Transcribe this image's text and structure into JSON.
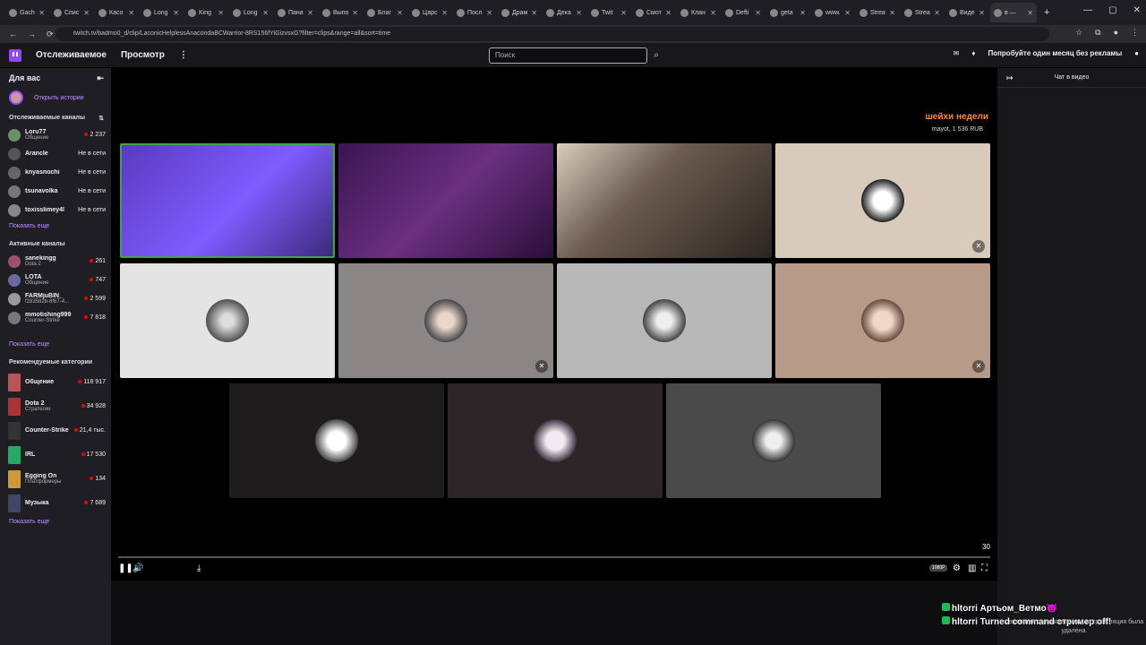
{
  "browser": {
    "tabs": [
      "Gach",
      "Спис",
      "Касо",
      "Long",
      "King",
      "Long",
      "Пана",
      "Выпо",
      "Благ",
      "Царс",
      "Посл",
      "Драм",
      "Дека",
      "Twit",
      "Смот",
      "Клан",
      "Defti",
      "geta",
      "www.",
      "Strea",
      "Strea",
      "Виде",
      "в —"
    ],
    "url": "twitch.tv/badmo0_d/clip/LaconicHelplessAnacondaBCWarrior-8RS156fYiGizvsxG?filter=clips&range=all&sort=time"
  },
  "topnav": {
    "following": "Отслеживаемое",
    "browse": "Просмотр",
    "more": "⋮",
    "search_placeholder": "Поиск",
    "promo": "Попробуйте один месяц без рекламы"
  },
  "sidebar": {
    "for_you": "Для вас",
    "stories": "Открыть истории",
    "followed_title": "Отслеживаемые каналы",
    "followed": [
      {
        "name": "Loru77",
        "game": "Общение",
        "viewers": "2 237",
        "live": true
      },
      {
        "name": "Arancle",
        "game": "",
        "viewers": "Не в сети",
        "live": false
      },
      {
        "name": "knyasnochi",
        "game": "",
        "viewers": "Не в сети",
        "live": false
      },
      {
        "name": "tsunavolka",
        "game": "",
        "viewers": "Не в сети",
        "live": false
      },
      {
        "name": "toxisslimey4l",
        "game": "",
        "viewers": "Не в сети",
        "live": false
      }
    ],
    "show_more_1": "Показать еще",
    "active_title": "Активные каналы",
    "active": [
      {
        "name": "sanekingg",
        "game": "Dota 2",
        "viewers": "261",
        "live": true
      },
      {
        "name": "LOTA",
        "game": "Общение",
        "viewers": "747",
        "live": true
      },
      {
        "name": "FARMjuBIN_",
        "game": "f283582b-8f67-4...",
        "viewers": "2 599",
        "live": true
      },
      {
        "name": "mmotishing999",
        "game": "Counter-Strike",
        "viewers": "7 818",
        "live": true
      }
    ],
    "show_more_2": "Показать еще",
    "rec_title": "Рекомендуемые категории",
    "categories": [
      {
        "name": "Общение",
        "sub": "",
        "viewers": "118 917"
      },
      {
        "name": "Dota 2",
        "sub": "Стратегии",
        "viewers": "34 928"
      },
      {
        "name": "Counter-Strike",
        "sub": "",
        "viewers": "21,4 тыс."
      },
      {
        "name": "IRL",
        "sub": "",
        "viewers": "17 530"
      },
      {
        "name": "Egging On",
        "sub": "Платформеры",
        "viewers": "134"
      },
      {
        "name": "Музыка",
        "sub": "",
        "viewers": "7 689"
      }
    ],
    "show_more_3": "Показать еще"
  },
  "player": {
    "overlay_title": "шейхи недели",
    "overlay_sub": "mayot, 1 536 RUB",
    "timer": "30",
    "quality": "1080P"
  },
  "chat": {
    "title": "Чат в видео",
    "overlay_lines": [
      "hltorri Артьом_Ветмо😈",
      "hltorri Turned command стример off!"
    ],
    "note": "связанная с клипом прошлая трансляция была удалена."
  }
}
